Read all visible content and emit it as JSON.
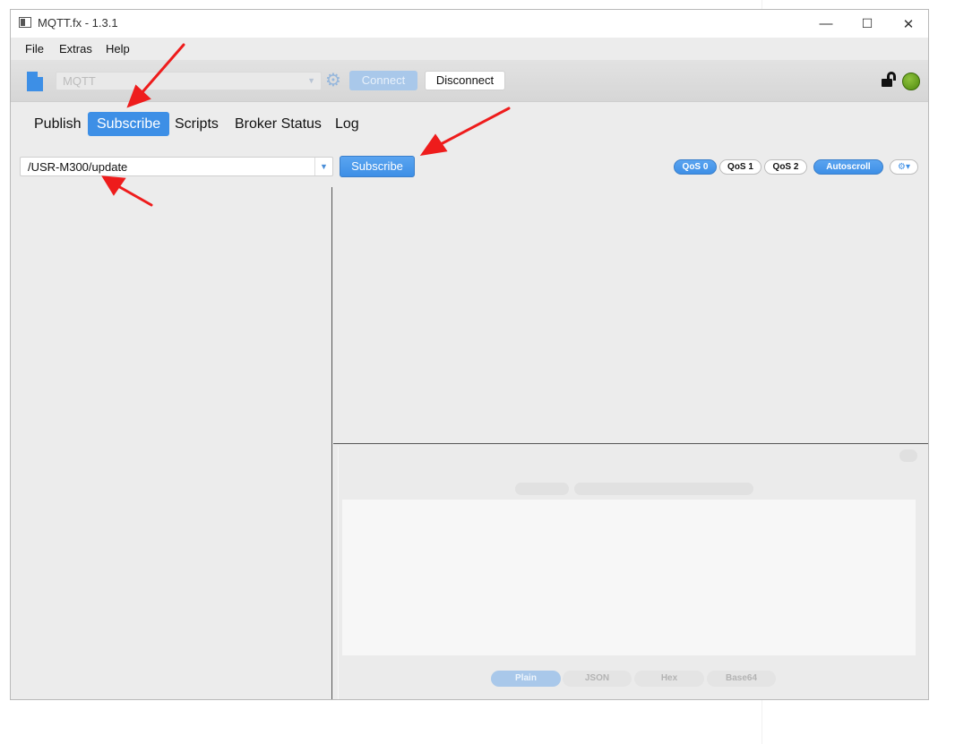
{
  "window": {
    "title": "MQTT.fx - 1.3.1",
    "controls": {
      "minimize": "—",
      "maximize": "☐",
      "close": "✕"
    }
  },
  "menu": {
    "items": [
      "File",
      "Extras",
      "Help"
    ]
  },
  "toolbar": {
    "profile": "MQTT",
    "connect_label": "Connect",
    "disconnect_label": "Disconnect",
    "status_color": "#6aa81f",
    "icons": [
      "document-icon",
      "gear-icon",
      "unlock-icon",
      "status-led-icon"
    ]
  },
  "tabs": [
    {
      "label": "Publish",
      "active": false
    },
    {
      "label": "Subscribe",
      "active": true
    },
    {
      "label": "Scripts",
      "active": false
    },
    {
      "label": "Broker Status",
      "active": false
    },
    {
      "label": "Log",
      "active": false
    }
  ],
  "subscribe": {
    "topic": "/USR-M300/update",
    "button_label": "Subscribe",
    "qos": [
      "QoS 0",
      "QoS 1",
      "QoS 2"
    ],
    "qos_selected": "QoS 0",
    "autoscroll_label": "Autoscroll",
    "settings_icon": "⚙▾"
  },
  "payload_formats": {
    "options": [
      "Plain",
      "JSON",
      "Hex",
      "Base64"
    ],
    "selected": "Plain"
  },
  "colors": {
    "accent": "#3d8fe6",
    "annotation_arrow": "#ee1c1c"
  }
}
